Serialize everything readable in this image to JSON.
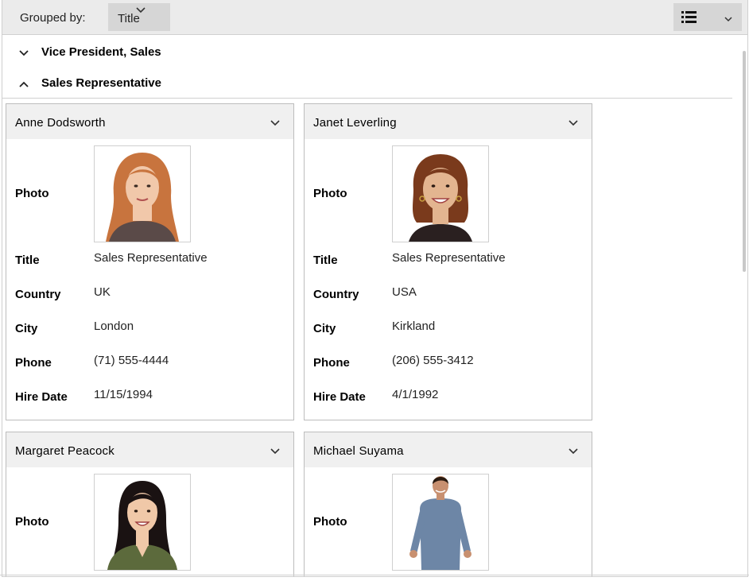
{
  "toolbar": {
    "grouped_by_label": "Grouped by:",
    "group_field": "Title"
  },
  "groups": [
    {
      "title": "Vice President, Sales",
      "state": "collapsed"
    },
    {
      "title": "Sales Representative",
      "state": "expanded"
    }
  ],
  "field_labels": {
    "photo": "Photo",
    "title": "Title",
    "country": "Country",
    "city": "City",
    "phone": "Phone",
    "hire_date": "Hire Date"
  },
  "cards": [
    {
      "name": "Anne  Dodsworth",
      "title": "Sales Representative",
      "country": "UK",
      "city": "London",
      "phone": "(71) 555-4444",
      "hire_date": "11/15/1994",
      "photo_colors": {
        "hair": "#c8743e",
        "skin": "#f1c8aa",
        "clothes": "#5a4a48"
      }
    },
    {
      "name": "Janet  Leverling",
      "title": "Sales Representative",
      "country": "USA",
      "city": "Kirkland",
      "phone": "(206) 555-3412",
      "hire_date": "4/1/1992",
      "photo_colors": {
        "hair": "#7a3a1c",
        "skin": "#e3b590",
        "clothes": "#2a2020"
      }
    },
    {
      "name": "Margaret  Peacock",
      "photo_colors": {
        "hair": "#1a1212",
        "skin": "#f0c8a8",
        "clothes": "#5c6a3c"
      }
    },
    {
      "name": "Michael  Suyama",
      "photo_colors": {
        "hair": "#2a1a10",
        "skin": "#c89070",
        "clothes": "#6d86a6"
      }
    }
  ]
}
